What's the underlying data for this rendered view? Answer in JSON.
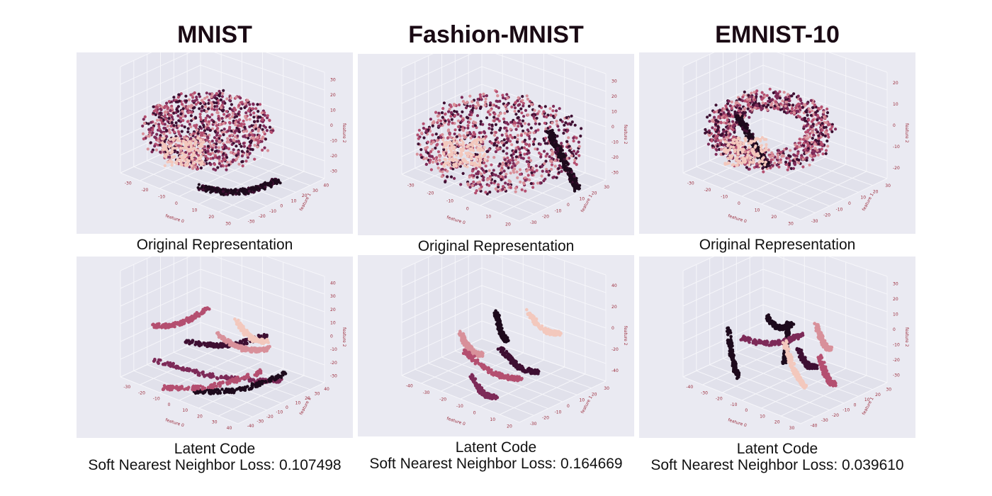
{
  "figure": {
    "columns": [
      {
        "title": "MNIST",
        "top_caption": "Original Representation",
        "bottom_caption_line1": "Latent Code",
        "bottom_caption_line2": "Soft Nearest Neighbor Loss: 0.107498"
      },
      {
        "title": "Fashion-MNIST",
        "top_caption": "Original Representation",
        "bottom_caption_line1": "Latent Code",
        "bottom_caption_line2": "Soft Nearest Neighbor Loss: 0.164669"
      },
      {
        "title": "EMNIST-10",
        "top_caption": "Original Representation",
        "bottom_caption_line1": "Latent Code",
        "bottom_caption_line2": "Soft Nearest Neighbor Loss: 0.039610"
      }
    ]
  },
  "chart_data": [
    {
      "type": "scatter",
      "title": "MNIST",
      "subtitle": "Original Representation",
      "xlabel": "feature 0",
      "ylabel": "feature 1",
      "zlabel": "feature 2",
      "xticks": [
        -30,
        -20,
        -10,
        0,
        10,
        20,
        30
      ],
      "yticks": [
        -30,
        -20,
        -10,
        0,
        10,
        20,
        30,
        40
      ],
      "zticks": [
        -30,
        -20,
        -10,
        0,
        10,
        20,
        30
      ],
      "colors": [
        "#f3c8bd",
        "#d8909a",
        "#b44f70",
        "#7d2a58",
        "#3e0f32",
        "#1d0a1c"
      ],
      "grid": true,
      "points": []
    },
    {
      "type": "scatter",
      "title": "Fashion-MNIST",
      "subtitle": "Original Representation",
      "xlabel": "feature 0",
      "ylabel": "feature 1",
      "zlabel": "feature 2",
      "xticks": [
        -30,
        -20,
        -10,
        0,
        10,
        20
      ],
      "yticks": [
        -30,
        -20,
        -10,
        0,
        10,
        20,
        30
      ],
      "zticks": [
        -30,
        -20,
        -10,
        0,
        10,
        20,
        30
      ],
      "colors": [
        "#f3c8bd",
        "#d8909a",
        "#b44f70",
        "#7d2a58",
        "#3e0f32",
        "#1d0a1c"
      ],
      "grid": true,
      "points": []
    },
    {
      "type": "scatter",
      "title": "EMNIST-10",
      "subtitle": "Original Representation",
      "xlabel": "feature 0",
      "ylabel": "feature 1",
      "zlabel": "feature 2",
      "xticks": [
        -30,
        -20,
        -10,
        0,
        10,
        20,
        30
      ],
      "yticks": [
        -30,
        -20,
        -10,
        0,
        10,
        20,
        30
      ],
      "zticks": [
        -20,
        -10,
        0,
        10,
        20
      ],
      "colors": [
        "#f3c8bd",
        "#d8909a",
        "#b44f70",
        "#7d2a58",
        "#3e0f32",
        "#1d0a1c"
      ],
      "grid": true,
      "points": []
    },
    {
      "type": "scatter",
      "title": "MNIST",
      "subtitle": "Latent Code",
      "xlabel": "feature 0",
      "ylabel": "feature 1",
      "zlabel": "feature 2",
      "xticks": [
        -30,
        -20,
        -10,
        0,
        10,
        20,
        30,
        40
      ],
      "yticks": [
        -40,
        -30,
        -20,
        -10,
        0,
        10,
        20,
        30,
        40
      ],
      "zticks": [
        -30,
        -20,
        -10,
        0,
        10,
        20,
        30,
        40
      ],
      "colors": [
        "#f3c8bd",
        "#d8909a",
        "#b44f70",
        "#7d2a58",
        "#3e0f32",
        "#1d0a1c"
      ],
      "grid": true,
      "points": []
    },
    {
      "type": "scatter",
      "title": "Fashion-MNIST",
      "subtitle": "Latent Code",
      "xlabel": "feature 0",
      "ylabel": "feature 1",
      "zlabel": "feature 2",
      "xticks": [
        -40,
        -30,
        -20,
        -10,
        0,
        10,
        20
      ],
      "yticks": [
        -30,
        -20,
        -10,
        0,
        10,
        20,
        30
      ],
      "zticks": [
        -40,
        -20,
        0,
        20,
        40
      ],
      "colors": [
        "#f3c8bd",
        "#d8909a",
        "#b44f70",
        "#7d2a58",
        "#3e0f32",
        "#1d0a1c"
      ],
      "grid": true,
      "points": []
    },
    {
      "type": "scatter",
      "title": "EMNIST-10",
      "subtitle": "Latent Code",
      "xlabel": "feature 0",
      "ylabel": "feature 1",
      "zlabel": "feature 2",
      "xticks": [
        -40,
        -30,
        -20,
        -10,
        0,
        10,
        20,
        30
      ],
      "yticks": [
        -40,
        -30,
        -20,
        -10,
        0,
        10,
        20,
        30
      ],
      "zticks": [
        -30,
        -20,
        -10,
        0,
        10,
        20,
        30
      ],
      "colors": [
        "#f3c8bd",
        "#d8909a",
        "#b44f70",
        "#7d2a58",
        "#3e0f32",
        "#1d0a1c"
      ],
      "grid": true,
      "points": []
    }
  ]
}
